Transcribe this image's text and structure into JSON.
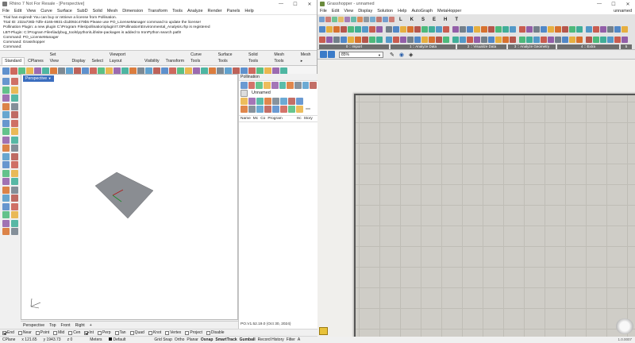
{
  "rhino": {
    "title": "Rhino 7 Not For Resale - [Perspective]",
    "menu": [
      "File",
      "Edit",
      "View",
      "Curve",
      "Surface",
      "SubD",
      "Solid",
      "Mesh",
      "Dimension",
      "Transform",
      "Tools",
      "Analyze",
      "Render",
      "Panels",
      "Help"
    ],
    "command_history": [
      "Trial has expired! You can buy or retrieve a license from Pollination.",
      "Trial ID: 232a736b-7dfe-4165-9931-d1d092c479b5 Please use PO_LicenseManager command to update the license!",
      "Pollination Plugin: a new plugin C:\\Program Files\\pollination\\plugin\\7.0\\Pollination\\Environmental_Analysis.rhp is registered",
      "LBT-Plugin: C:\\Program Files\\ladybug_tools\\python\\Lib\\site-packages is added to IronPython search path!",
      "Command: PO_LicenseManager",
      "Command: Grasshopper",
      "Command:"
    ],
    "toolbar_tabs": [
      "Standard",
      "CPlanes",
      "Set View",
      "Display",
      "Select",
      "Viewport Layout",
      "Visibility",
      "Transform",
      "Curve Tools",
      "Surface Tools",
      "Solid Tools",
      "Mesh Tools",
      "Mesh ▸"
    ],
    "viewport_tab": "Perspective",
    "view_tabs": [
      "Perspective",
      "Top",
      "Front",
      "Right",
      "+"
    ],
    "osnaps": [
      {
        "label": "End",
        "on": true
      },
      {
        "label": "Near",
        "on": false
      },
      {
        "label": "Point",
        "on": false
      },
      {
        "label": "Mid",
        "on": false
      },
      {
        "label": "Cen",
        "on": false
      },
      {
        "label": "Int",
        "on": true
      },
      {
        "label": "Perp",
        "on": false
      },
      {
        "label": "Tan",
        "on": false
      },
      {
        "label": "Quad",
        "on": false
      },
      {
        "label": "Knot",
        "on": false
      },
      {
        "label": "Vertex",
        "on": false
      },
      {
        "label": "Project",
        "on": false
      },
      {
        "label": "Disable",
        "on": false
      }
    ],
    "status": {
      "cplane": "CPlane",
      "x": "x 121.65",
      "y": "y 1943.73",
      "z": "z 0",
      "units": "Meters",
      "layer": "Default",
      "toggles": [
        "Grid Snap",
        "Ortho",
        "Planar",
        "Osnap",
        "SmartTrack",
        "Gumball",
        "Record History",
        "Filter",
        "A"
      ]
    },
    "panel": {
      "title": "Pollination",
      "model_name": "Unnamed",
      "filter_placeholder": "Filter",
      "columns": [
        "Name",
        "Mc",
        "Co",
        "Program",
        "Hc",
        "Story"
      ],
      "version": "PO.V1.52.19.0 (Oct 30, 2024)"
    }
  },
  "grasshopper": {
    "title": "Grasshopper - unnamed",
    "menu": [
      "File",
      "Edit",
      "View",
      "Display",
      "Solution",
      "Help",
      "AutoGraph",
      "MetaHopper"
    ],
    "doc_name": "unnamed",
    "tab_letters": [
      "L",
      "K",
      "S",
      "E",
      "H",
      "T"
    ],
    "sections": [
      "0 :: Import",
      "1 :: Analyze Data",
      "2 :: Visualize Data",
      "3 :: Analyze Geometry",
      "4 :: Extra",
      "5"
    ],
    "zoom": "85%",
    "footer_version": "1.0.0007"
  }
}
